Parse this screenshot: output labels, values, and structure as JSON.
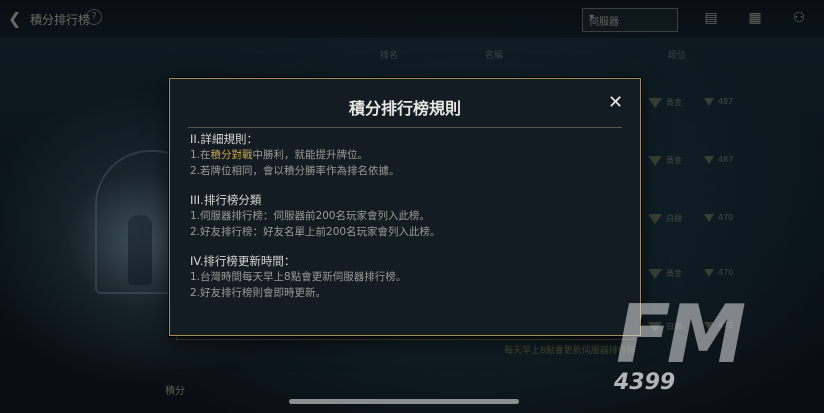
{
  "topbar": {
    "title": "積分排行榜",
    "help": "?",
    "server_select": "伺服器",
    "icons": [
      "list-icon",
      "grid-icon",
      "friends-icon"
    ]
  },
  "columns": [
    "排名",
    "名稱",
    "段位"
  ],
  "rank_rows": [
    {
      "tier": "黃金",
      "score": "487"
    },
    {
      "tier": "黃金",
      "score": "487"
    },
    {
      "tier": "白銀",
      "score": "470"
    },
    {
      "tier": "黃金",
      "score": "470"
    },
    {
      "tier": "白銀",
      "score": "472"
    }
  ],
  "bottom_note": "每天早上8點會更新伺服器排行榜",
  "bottom_tab": "積分",
  "watermark": {
    "big": "FM",
    "small": "4399"
  },
  "modal": {
    "title": "積分排行榜規則",
    "close": "✕",
    "sections": [
      {
        "title": "II.詳細規則：",
        "lines": [
          {
            "prefix": "1.在",
            "highlight": "積分對戰",
            "suffix": "中勝利，就能提升牌位。"
          },
          {
            "prefix": "2.若牌位相同，會以積分勝率作為排名依據。",
            "highlight": "",
            "suffix": ""
          }
        ]
      },
      {
        "title": "III.排行榜分類",
        "lines": [
          {
            "prefix": "1.伺服器排行榜：伺服器前200名玩家會列入此榜。",
            "highlight": "",
            "suffix": ""
          },
          {
            "prefix": "2.好友排行榜：好友名單上前200名玩家會列入此榜。",
            "highlight": "",
            "suffix": ""
          }
        ]
      },
      {
        "title": "IV.排行榜更新時間：",
        "lines": [
          {
            "prefix": "1.台灣時間每天早上8點會更新伺服器排行榜。",
            "highlight": "",
            "suffix": ""
          },
          {
            "prefix": "2.好友排行榜則會即時更新。",
            "highlight": "",
            "suffix": ""
          }
        ]
      }
    ]
  },
  "colors": {
    "accent_gold": "#c9a24a",
    "modal_border": "#a08c57",
    "modal_bg": "#131c22"
  }
}
